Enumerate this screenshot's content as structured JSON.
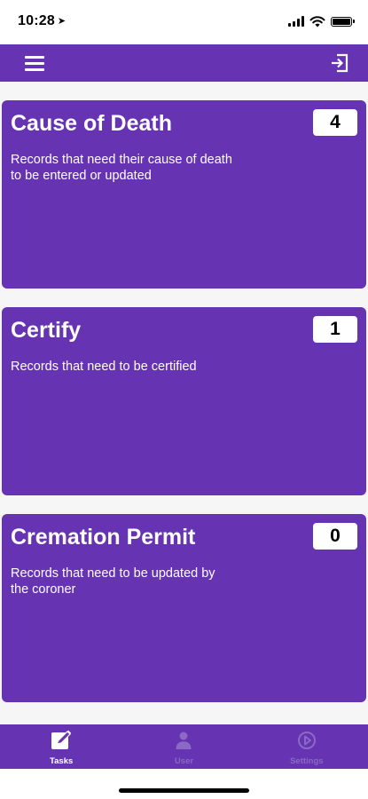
{
  "status_bar": {
    "time": "10:28",
    "icons": [
      "location-arrow-icon",
      "cellular-signal-icon",
      "wifi-icon",
      "battery-icon"
    ]
  },
  "header": {
    "icons": [
      "hamburger-menu-icon",
      "logout-icon"
    ],
    "color": "#6633b2"
  },
  "tasks": [
    {
      "title": "Cause of Death",
      "count": "4",
      "description": "Records that need their cause of death to be entered or updated"
    },
    {
      "title": "Certify",
      "count": "1",
      "description": "Records that need to be certified"
    },
    {
      "title": "Cremation Permit",
      "count": "0",
      "description": "Records that need to be updated by the coroner"
    }
  ],
  "tab_bar": {
    "tabs": [
      {
        "label": "Tasks",
        "icon": "edit-pencil-icon",
        "active": true
      },
      {
        "label": "User",
        "icon": "user-icon",
        "active": false
      },
      {
        "label": "Settings",
        "icon": "settings-icon",
        "active": false
      }
    ]
  },
  "colors": {
    "primary": "#6633b2",
    "tab_inactive": "#8a6ac4",
    "background": "#f6f6f6"
  }
}
